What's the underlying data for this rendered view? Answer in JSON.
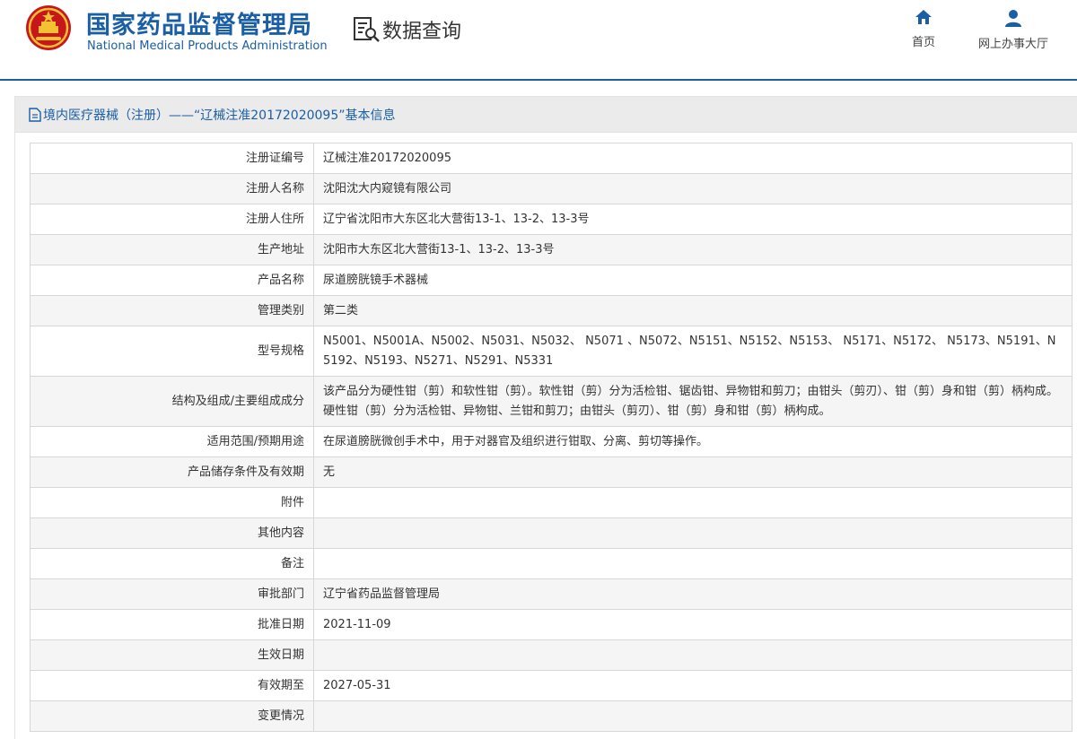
{
  "header": {
    "brand_cn": "国家药品监督管理局",
    "brand_en": "National Medical Products Administration",
    "query_title": "数据查询",
    "nav": {
      "home_label": "首页",
      "hall_label": "网上办事大厅"
    }
  },
  "panel": {
    "title": "境内医疗器械（注册）——“辽械注准20172020095”基本信息"
  },
  "rows": [
    {
      "label": "注册证编号",
      "value": "辽械注准20172020095"
    },
    {
      "label": "注册人名称",
      "value": "沈阳沈大内窥镜有限公司"
    },
    {
      "label": "注册人住所",
      "value": "辽宁省沈阳市大东区北大营街13-1、13-2、13-3号"
    },
    {
      "label": "生产地址",
      "value": "沈阳市大东区北大营街13-1、13-2、13-3号"
    },
    {
      "label": "产品名称",
      "value": "尿道膀胱镜手术器械"
    },
    {
      "label": "管理类别",
      "value": "第二类"
    },
    {
      "label": "型号规格",
      "value": "N5001、N5001A、N5002、N5031、N5032、 N5071 、N5072、N5151、N5152、N5153、 N5171、N5172、 N5173、N5191、N5192、N5193、N5271、N5291、N5331"
    },
    {
      "label": "结构及组成/主要组成成分",
      "value": "该产品分为硬性钳（剪）和软性钳（剪）。软性钳（剪）分为活检钳、锯齿钳、异物钳和剪刀；由钳头（剪刃）、钳（剪）身和钳（剪）柄构成。硬性钳（剪）分为活检钳、异物钳、兰钳和剪刀；由钳头（剪刃）、钳（剪）身和钳（剪）柄构成。"
    },
    {
      "label": "适用范围/预期用途",
      "value": "在尿道膀胱微创手术中，用于对器官及组织进行钳取、分离、剪切等操作。"
    },
    {
      "label": "产品储存条件及有效期",
      "value": "无"
    },
    {
      "label": "附件",
      "value": ""
    },
    {
      "label": "其他内容",
      "value": ""
    },
    {
      "label": "备注",
      "value": ""
    },
    {
      "label": "审批部门",
      "value": "辽宁省药品监督管理局"
    },
    {
      "label": "批准日期",
      "value": "2021-11-09"
    },
    {
      "label": "生效日期",
      "value": ""
    },
    {
      "label": "有效期至",
      "value": "2027-05-31"
    },
    {
      "label": "变更情况",
      "value": ""
    }
  ],
  "colors": {
    "brand_blue": "#1a5ea5",
    "emblem_red": "#c8161d",
    "emblem_gold": "#f2c230"
  }
}
